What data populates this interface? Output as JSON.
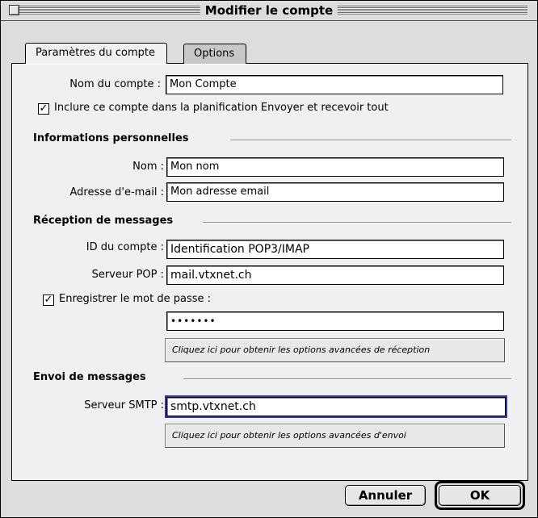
{
  "window": {
    "title": "Modifier le compte"
  },
  "tabs": [
    {
      "label": "Paramètres du compte",
      "active": true
    },
    {
      "label": "Options",
      "active": false
    }
  ],
  "account": {
    "name_label": "Nom du compte :",
    "name_value": "Mon Compte",
    "include_checked": true,
    "include_label": "Inclure ce compte dans la planification Envoyer et recevoir tout"
  },
  "personal": {
    "heading": "Informations personnelles",
    "name_label": "Nom :",
    "name_value": "Mon nom",
    "email_label": "Adresse d'e-mail :",
    "email_value": "Mon adresse email"
  },
  "receiving": {
    "heading": "Réception de messages",
    "account_id_label": "ID du compte :",
    "account_id_value": "Identification POP3/IMAP",
    "pop_label": "Serveur POP :",
    "pop_value": "mail.vtxnet.ch",
    "save_password_checked": true,
    "save_password_label": "Enregistrer le mot de passe :",
    "password_value": "•••••••",
    "advanced_button": "Cliquez ici pour obtenir les options avancées de réception"
  },
  "sending": {
    "heading": "Envoi de messages",
    "smtp_label": "Serveur SMTP :",
    "smtp_value": "smtp.vtxnet.ch",
    "advanced_button": "Cliquez ici pour obtenir les options avancées d'envoi"
  },
  "buttons": {
    "cancel": "Annuler",
    "ok": "OK"
  },
  "icons": {
    "checkmark": "✓"
  }
}
